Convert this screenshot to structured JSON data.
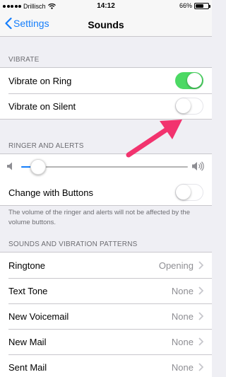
{
  "status_bar": {
    "carrier": "Drillisch",
    "time": "14:12",
    "battery": "66%",
    "battery_level": 0.66
  },
  "nav": {
    "back_label": "Settings",
    "title": "Sounds"
  },
  "vibrate": {
    "header": "VIBRATE",
    "items": [
      {
        "label": "Vibrate on Ring",
        "on": true
      },
      {
        "label": "Vibrate on Silent",
        "on": false
      }
    ]
  },
  "ringer": {
    "header": "RINGER AND ALERTS",
    "volume_level": 0.1,
    "change_with_buttons": {
      "label": "Change with Buttons",
      "on": false
    },
    "footer": "The volume of the ringer and alerts will not be affected by the volume buttons."
  },
  "patterns": {
    "header": "SOUNDS AND VIBRATION PATTERNS",
    "items": [
      {
        "label": "Ringtone",
        "value": "Opening"
      },
      {
        "label": "Text Tone",
        "value": "None"
      },
      {
        "label": "New Voicemail",
        "value": "None"
      },
      {
        "label": "New Mail",
        "value": "None"
      },
      {
        "label": "Sent Mail",
        "value": "None"
      }
    ]
  },
  "colors": {
    "accent": "#157efb",
    "toggle_on": "#4cd964",
    "annotation_arrow": "#f2336e"
  }
}
